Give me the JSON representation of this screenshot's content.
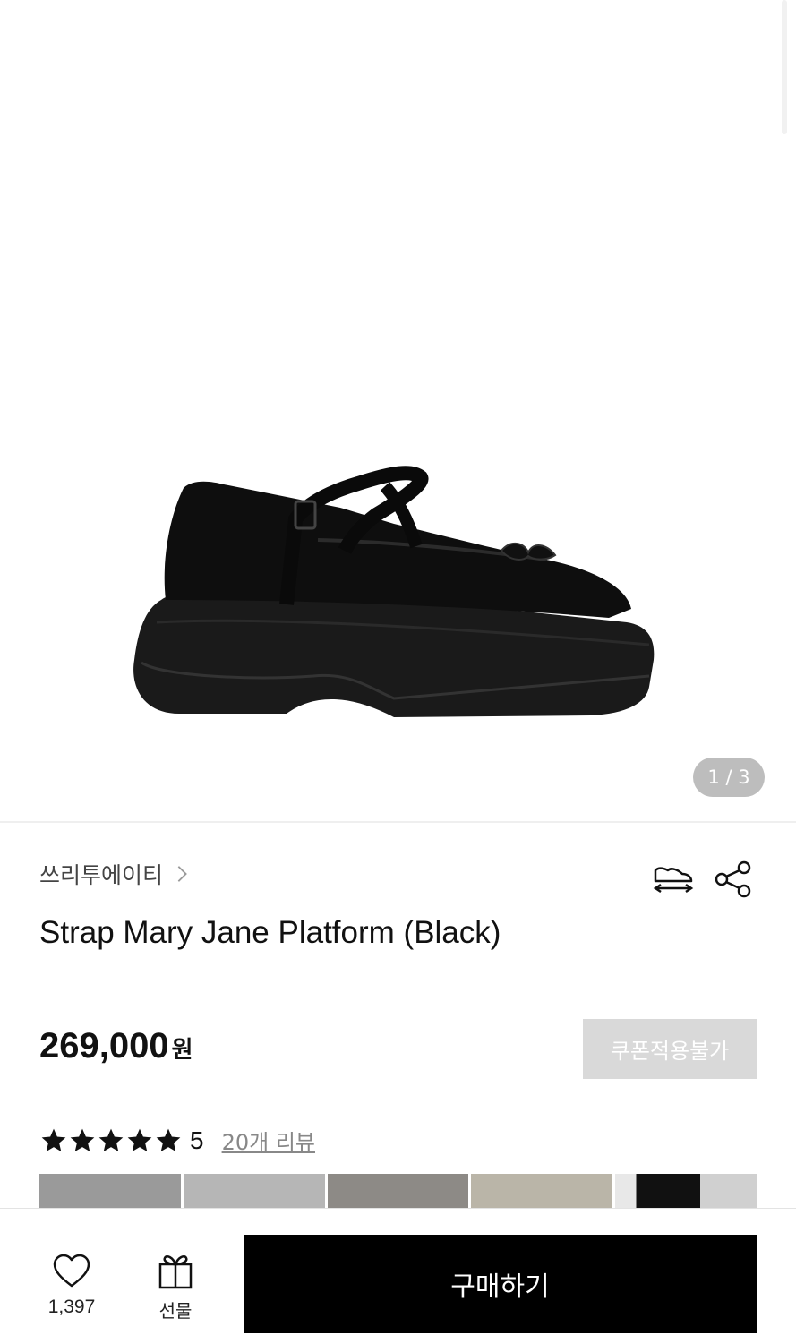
{
  "gallery": {
    "counter": "1 / 3",
    "image_alt": "black strap mary jane platform shoe"
  },
  "product": {
    "brand": "쓰리투에이티",
    "title": "Strap Mary Jane Platform (Black)",
    "price": "269,000",
    "currency": "원",
    "coupon_label": "쿠폰적용불가"
  },
  "rating": {
    "stars": 5,
    "score": "5",
    "review_link": "20개 리뷰"
  },
  "icons": {
    "brand_chevron": "chevron-right-icon",
    "size": "shoe-size-icon",
    "share": "share-icon",
    "like": "heart-icon",
    "gift": "gift-icon"
  },
  "bottom": {
    "like_count": "1,397",
    "gift_label": "선물",
    "buy_label": "구매하기"
  },
  "colors": {
    "coupon_bg": "#d9d9d9",
    "buy_bg": "#000000",
    "counter_bg": "#bdbdbd"
  }
}
